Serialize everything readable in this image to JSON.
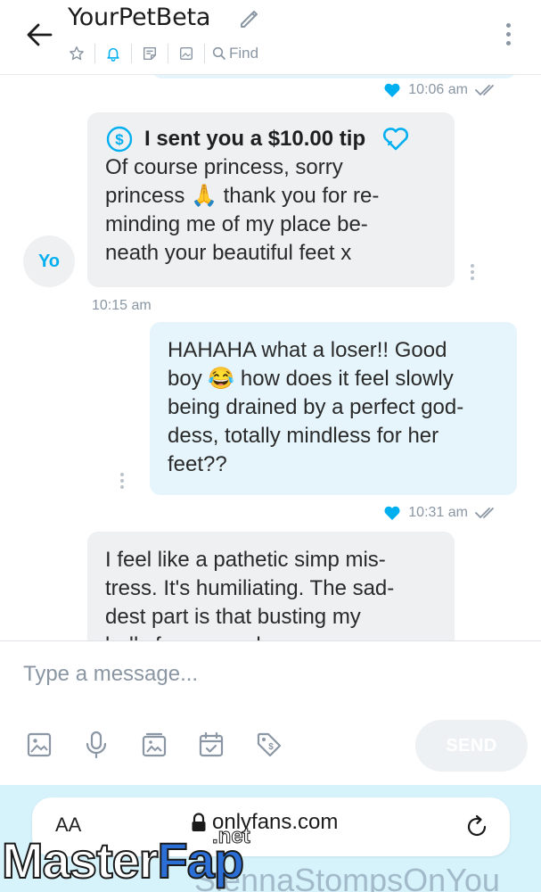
{
  "header": {
    "title": "YourPetBeta",
    "find_label": "Find"
  },
  "chat": {
    "previous_status": {
      "time": "10:06 am"
    },
    "messages": [
      {
        "tip_text": "I sent you a $10.00 tip",
        "lines": [
          "Of course princess, sorry",
          "princess 🙏 thank you for re-",
          "minding me of my place be-",
          "neath your beautiful feet x"
        ],
        "time": "10:15 am",
        "avatar_initials": "Yo"
      },
      {
        "lines": [
          "HAHAHA what a loser!! Good",
          "boy 😂 how does it feel slowly",
          "being drained by a perfect god-",
          "dess, totally mindless for her",
          "feet??"
        ],
        "time": "10:31 am"
      },
      {
        "lines": [
          "I feel like a pathetic simp mis-",
          "tress. It's humiliating. The sad-",
          "dest part is that busting my",
          "balls for you makes me"
        ]
      }
    ]
  },
  "composer": {
    "placeholder": "Type a message...",
    "send_label": "SEND"
  },
  "browser": {
    "aa_label": "AA",
    "url": "onlyfans.com"
  },
  "watermark": {
    "brand_master": "Master",
    "brand_fap": "Fap",
    "brand_net": ".net",
    "channel": "SiennaStompsOnYou"
  },
  "colors": {
    "accent": "#00aff0",
    "incoming_bubble": "#eef0f2",
    "outgoing_bubble": "#e5f5fb",
    "muted_text": "#8a96a3"
  }
}
